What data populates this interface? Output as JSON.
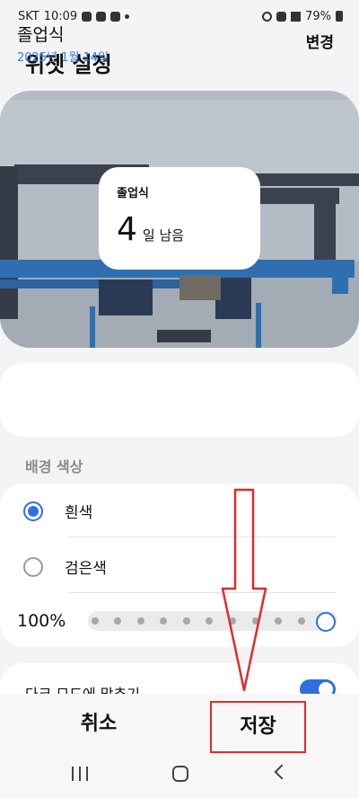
{
  "status_bar": {
    "carrier": "SKT",
    "time": "10:09",
    "battery": "79%"
  },
  "header": {
    "title": "위젯 설정"
  },
  "widget_preview": {
    "event_name": "졸업식",
    "days_number": "4",
    "days_suffix": "일 남음"
  },
  "event": {
    "name": "졸업식",
    "date": "2025년 1월 14일",
    "change_label": "변경"
  },
  "background_color": {
    "section_label": "배경 색상",
    "options": [
      {
        "label": "흰색",
        "selected": true
      },
      {
        "label": "검은색",
        "selected": false
      }
    ],
    "opacity_label": "100%",
    "opacity_value": 1.0
  },
  "dark_mode": {
    "label": "다크 모드에 맞추기",
    "enabled": true
  },
  "actions": {
    "cancel_label": "취소",
    "save_label": "저장"
  },
  "nav": {
    "recents_icon": "recents-icon",
    "home_icon": "home-icon",
    "back_icon": "back-icon"
  },
  "colors": {
    "accent": "#2f6fe0",
    "annotation_red": "#e12b2b",
    "date_blue": "#3a7fd5"
  }
}
